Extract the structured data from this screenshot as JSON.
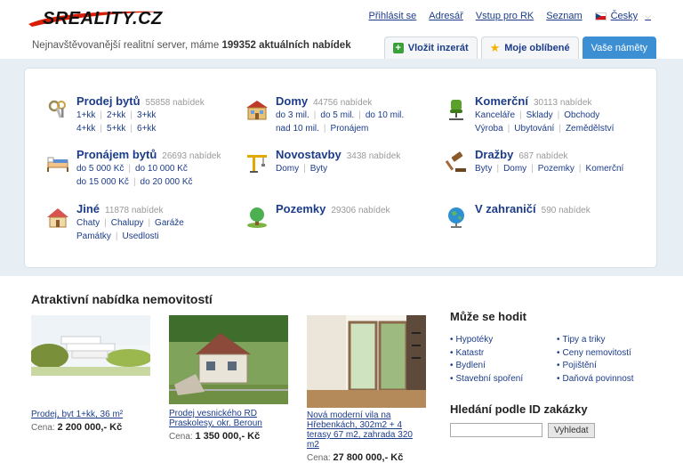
{
  "header": {
    "logo_text": "SREALITY.CZ",
    "nav": [
      "Přihlásit se",
      "Adresář",
      "Vstup pro RK",
      "Seznam"
    ],
    "language": "Česky",
    "tagline_prefix": "Nejnavštěvovanější realitní server, máme",
    "tagline_count": "199352 aktuálních nabídek",
    "tabs": {
      "add": "Vložit inzerát",
      "favorites": "Moje oblíbené",
      "themes": "Vaše náměty"
    }
  },
  "categories": {
    "sale_flats": {
      "title": "Prodej bytů",
      "count": "55858 nabídek",
      "links": [
        "1+kk",
        "2+kk",
        "3+kk",
        "4+kk",
        "5+kk",
        "6+kk"
      ]
    },
    "houses": {
      "title": "Domy",
      "count": "44756 nabídek",
      "links": [
        "do 3 mil.",
        "do 5 mil.",
        "do 10 mil.",
        "nad 10 mil.",
        "Pronájem"
      ]
    },
    "commercial": {
      "title": "Komerční",
      "count": "30113 nabídek",
      "links": [
        "Kanceláře",
        "Sklady",
        "Obchody",
        "Výroba",
        "Ubytování",
        "Zemědělství"
      ]
    },
    "rent_flats": {
      "title": "Pronájem bytů",
      "count": "26693 nabídek",
      "links": [
        "do 5 000 Kč",
        "do 10 000 Kč",
        "do 15 000 Kč",
        "do 20 000 Kč"
      ]
    },
    "new_builds": {
      "title": "Novostavby",
      "count": "3438 nabídek",
      "links": [
        "Domy",
        "Byty"
      ]
    },
    "auctions": {
      "title": "Dražby",
      "count": "687 nabídek",
      "links": [
        "Byty",
        "Domy",
        "Pozemky",
        "Komerční"
      ]
    },
    "other": {
      "title": "Jiné",
      "count": "11878 nabídek",
      "links": [
        "Chaty",
        "Chalupy",
        "Garáže",
        "Památky",
        "Usedlosti"
      ]
    },
    "land": {
      "title": "Pozemky",
      "count": "29306 nabídek",
      "links": []
    },
    "abroad": {
      "title": "V zahraničí",
      "count": "590 nabídek",
      "links": []
    }
  },
  "offers": {
    "title": "Atraktivní nabídka nemovitostí",
    "price_label": "Cena:",
    "items": [
      {
        "title": "Prodej, byt 1+kk, 36 m²",
        "price": "2 200 000,- Kč"
      },
      {
        "title": "Prodej vesnického RD Praskolesy, okr. Beroun",
        "price": "1 350 000,- Kč"
      },
      {
        "title": "Nová moderní vila na Hřebenkách, 302m2 + 4 terasy 67 m2, zahrada 320 m2",
        "price": "27 800 000,- Kč"
      }
    ]
  },
  "useful": {
    "title": "Může se hodit",
    "left": [
      "Hypotéky",
      "Katastr",
      "Bydlení",
      "Stavební spoření"
    ],
    "right": [
      "Tipy a triky",
      "Ceny nemovitostí",
      "Pojištění",
      "Daňová povinnost"
    ]
  },
  "id_search": {
    "title": "Hledání podle ID zakázky",
    "input_value": "",
    "button": "Vyhledat"
  }
}
